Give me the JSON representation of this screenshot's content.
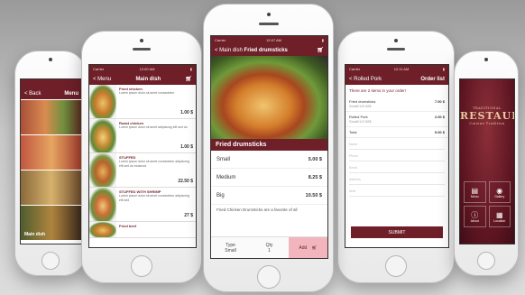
{
  "colors": {
    "brand": "#6e1f28",
    "accent_pink": "#f2b5bd",
    "background": "#c9c9c9"
  },
  "phone_left": {
    "nav": {
      "back": "Back",
      "title": "Menu"
    },
    "tiles": [
      {
        "label": ""
      },
      {
        "label": ""
      },
      {
        "label": ""
      },
      {
        "label": "Main dish"
      },
      {
        "label": ""
      }
    ]
  },
  "phone_mid_left": {
    "status": {
      "carrier": "Carrier",
      "time": "12:00 AM"
    },
    "nav": {
      "back": "Menu",
      "title": "Main dish",
      "cart_icon": "cart-icon"
    },
    "dishes": [
      {
        "title": "Fried chicken",
        "desc": "Lorem ipsum dolor sit amet consectetur",
        "price": "1.00 $"
      },
      {
        "title": "Roast chicken",
        "desc": "Lorem ipsum dolor sit amet adipiscing elit sed do",
        "price": "1.00 $"
      },
      {
        "title": "STUFFED",
        "desc": "Lorem ipsum dolor sit amet consectetur adipiscing elit sed do eiusmod",
        "price": "22.50 $"
      },
      {
        "title": "STUFFED WITH SHRIMP",
        "desc": "Lorem ipsum dolor sit amet consectetur adipiscing elit sed",
        "price": "27 $"
      },
      {
        "title": "Fried beef",
        "desc": "",
        "price": ""
      }
    ]
  },
  "phone_center": {
    "status": {
      "carrier": "Carrier",
      "time": "12:07 AM"
    },
    "nav": {
      "back": "Main dish",
      "title": "Fried drumsticks",
      "cart_icon": "cart-icon"
    },
    "section_title": "Fried drumsticks",
    "options": [
      {
        "name": "Small",
        "price": "5.00 $"
      },
      {
        "name": "Medium",
        "price": "8.25 $"
      },
      {
        "name": "Big",
        "price": "10.50 $"
      }
    ],
    "description": "Fried Chicken Drumsticks are a favorite of all",
    "bottom": {
      "type_label": "Type",
      "type_value": "Small",
      "qty_label": "Qty",
      "qty_value": "1",
      "add_label": "Add"
    }
  },
  "phone_mid_right": {
    "status": {
      "carrier": "Carrier",
      "time": "12:11 AM"
    },
    "nav": {
      "back": "Rolled Pork",
      "title": "Order list"
    },
    "heading": "There are 2 items in your order!",
    "items": [
      {
        "name": "Fried drumsticks",
        "detail": "Small/1/5.00$",
        "price": "7.00 $"
      },
      {
        "name": "Rolled Pork",
        "detail": "Small/1/2.00$",
        "price": "2.00 $"
      }
    ],
    "total_label": "Total",
    "total_value": "9.00 $",
    "inputs": [
      "Name",
      "Phone",
      "Email",
      "Address",
      "Note"
    ],
    "submit": "SUBMIT"
  },
  "phone_right": {
    "logo_top": "TRADITIONAL",
    "logo_main": "RESTAURANT",
    "logo_sub": "Cuisine Tradition",
    "tiles": [
      {
        "label": "Menu",
        "icon": "menu-book-icon"
      },
      {
        "label": "Gallery",
        "icon": "camera-icon"
      },
      {
        "label": "About",
        "icon": "info-icon"
      },
      {
        "label": "Location",
        "icon": "map-icon"
      }
    ]
  }
}
